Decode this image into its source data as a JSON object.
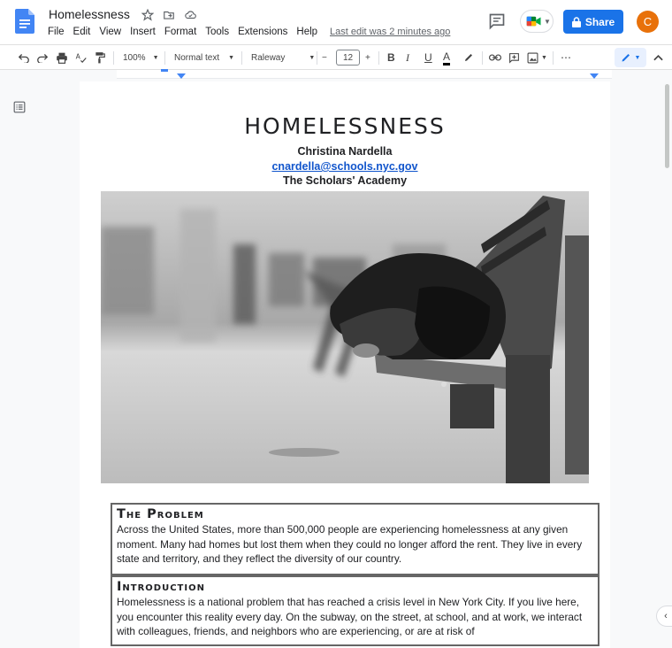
{
  "app": {
    "title": "Homelessness",
    "menu": [
      "File",
      "Edit",
      "View",
      "Insert",
      "Format",
      "Tools",
      "Extensions",
      "Help"
    ],
    "last_edit": "Last edit was 2 minutes ago",
    "share_label": "Share",
    "avatar_letter": "C"
  },
  "toolbar": {
    "zoom": "100%",
    "style": "Normal text",
    "font": "Raleway",
    "font_size": "12",
    "minus": "−",
    "plus": "+",
    "bold": "B",
    "italic": "I",
    "underline": "U",
    "text_color": "A",
    "more": "⋯"
  },
  "document": {
    "heading": "HOMELESSNESS",
    "author": "Christina Nardella",
    "email": "cnardella@schools.nyc.gov",
    "school": "The Scholars' Academy",
    "sections": [
      {
        "title": "The Problem",
        "text": "Across the United States, more than 500,000 people are experiencing homelessness at any given moment.  Many had homes but lost them when they could no longer afford the rent. They live in every state and territory, and they reflect the diversity of our country."
      },
      {
        "title": "Introduction",
        "text": "Homelessness is a national problem that has reached a crisis level in New York City. If you live here, you encounter this reality every day. On the subway, on the street, at school, and at work, we interact with colleagues, friends, and neighbors who are experiencing, or are at risk of"
      }
    ]
  },
  "colors": {
    "accent": "#1a73e8",
    "avatar": "#e8710a",
    "link": "#1155cc"
  },
  "icons": [
    "docs-logo-icon",
    "star-icon",
    "move-folder-icon",
    "cloud-status-icon",
    "comment-icon",
    "meet-icon",
    "lock-icon",
    "undo-icon",
    "redo-icon",
    "print-icon",
    "spellcheck-icon",
    "paint-format-icon",
    "highlight-icon",
    "link-icon",
    "add-comment-icon",
    "image-icon",
    "edit-mode-icon",
    "collapse-icon",
    "outline-icon"
  ]
}
